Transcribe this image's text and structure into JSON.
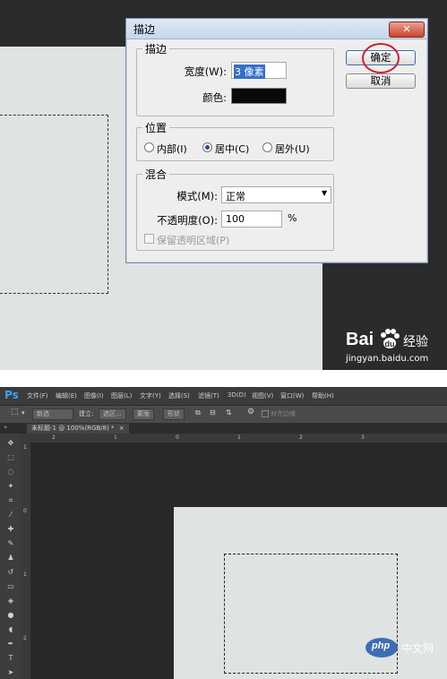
{
  "stroke_dialog": {
    "title": "描边",
    "close_label": "✕",
    "stroke_group": {
      "title": "描边",
      "width_label": "宽度(W):",
      "width_value": "3 像素",
      "color_label": "颜色:",
      "color_value": "#000000"
    },
    "position_group": {
      "title": "位置",
      "options": [
        {
          "label": "内部(I)",
          "selected": false
        },
        {
          "label": "居中(C)",
          "selected": true
        },
        {
          "label": "居外(U)",
          "selected": false
        }
      ]
    },
    "blend_group": {
      "title": "混合",
      "mode_label": "模式(M):",
      "mode_value": "正常",
      "opacity_label": "不透明度(O):",
      "opacity_value": "100",
      "opacity_unit": "%",
      "preserve_label": "保留透明区域(P)"
    },
    "ok_label": "确定",
    "cancel_label": "取消",
    "highlight_color": "#d0202a"
  },
  "watermark": {
    "brand": "Bai",
    "brand_suffix": "经验",
    "url": "jingyan.baidu.com"
  },
  "photoshop": {
    "logo": "Ps",
    "menu": [
      "文件(F)",
      "编辑(E)",
      "图像(I)",
      "图层(L)",
      "文字(Y)",
      "选择(S)",
      "滤镜(T)",
      "3D(D)",
      "视图(V)",
      "窗口(W)",
      "帮助(H)"
    ],
    "options": {
      "mode_value": "新选",
      "build_label": "建立:",
      "selection_button": "选区...",
      "mask_button": "蒙版",
      "shape_button": "形状",
      "align_edges_label": "对齐边缘"
    },
    "tab_label": "未标题-1 @ 100%(RGB/8) *",
    "tab_close": "×",
    "ruler_top_labels": [
      "2",
      "1",
      "0",
      "1",
      "2",
      "3"
    ],
    "ruler_left_labels": [
      "1",
      "0",
      "1",
      "2"
    ]
  },
  "site_logo": {
    "mark": "php",
    "text": "中文网"
  }
}
